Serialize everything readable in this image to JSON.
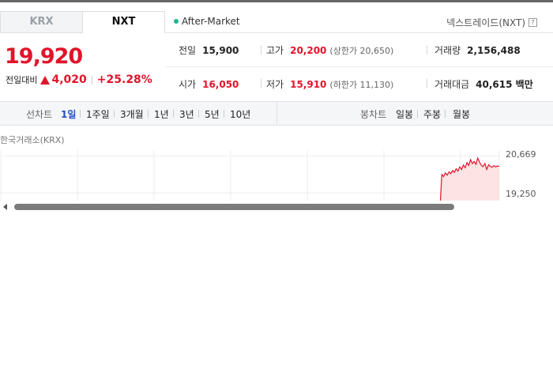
{
  "tabs": [
    {
      "label": "KRX",
      "active": false
    },
    {
      "label": "NXT",
      "active": true
    }
  ],
  "session": {
    "label": "After-Market",
    "color": "#1fb58f"
  },
  "exchange_label": "넥스트레이드(NXT)",
  "help_icon": "?",
  "price": {
    "current": "19,920",
    "change_label": "전일대비",
    "change_value": "4,020",
    "change_pct": "+25.28%",
    "direction": "up",
    "color": "#e0142a"
  },
  "info": {
    "prev_close": {
      "label": "전일",
      "value": "15,900"
    },
    "high": {
      "label": "고가",
      "value": "20,200",
      "sub": "(상한가 20,650)"
    },
    "volume": {
      "label": "거래량",
      "value": "2,156,488"
    },
    "open": {
      "label": "시가",
      "value": "16,050"
    },
    "low": {
      "label": "저가",
      "value": "15,910",
      "sub": "(하한가 11,130)"
    },
    "trade_value": {
      "label": "거래대금",
      "value": "40,615 백만"
    }
  },
  "period_bar": {
    "line_chart_label": "선차트",
    "line_periods": [
      "1일",
      "1주일",
      "3개월",
      "1년",
      "3년",
      "5년",
      "10년"
    ],
    "active_period": "1일",
    "candle_chart_label": "봉차트",
    "candle_periods": [
      "일봉",
      "주봉",
      "월봉"
    ]
  },
  "chart": {
    "source": "한국거래소(KRX)",
    "y_labels": [
      "20,669",
      "19,250"
    ],
    "line_color": "#e0142a",
    "fill_color": "#fde3e3"
  },
  "chart_data": {
    "type": "area",
    "title": "",
    "xlabel": "",
    "ylabel": "",
    "y_ticks": [
      20669,
      19250
    ],
    "series": [
      {
        "values": [
          18700,
          19960,
          19880,
          20020,
          19930,
          20060,
          19990,
          20110,
          20040,
          20180,
          20090,
          20250,
          20150,
          20320,
          20220,
          20420,
          20310,
          20530,
          20380,
          20460,
          20350,
          20590,
          20430,
          20310,
          20260,
          20380,
          20150,
          20330,
          20270,
          20240,
          20300,
          20250,
          20280,
          20270
        ]
      }
    ],
    "ylim": [
      18950,
      20900
    ],
    "grid": true
  }
}
